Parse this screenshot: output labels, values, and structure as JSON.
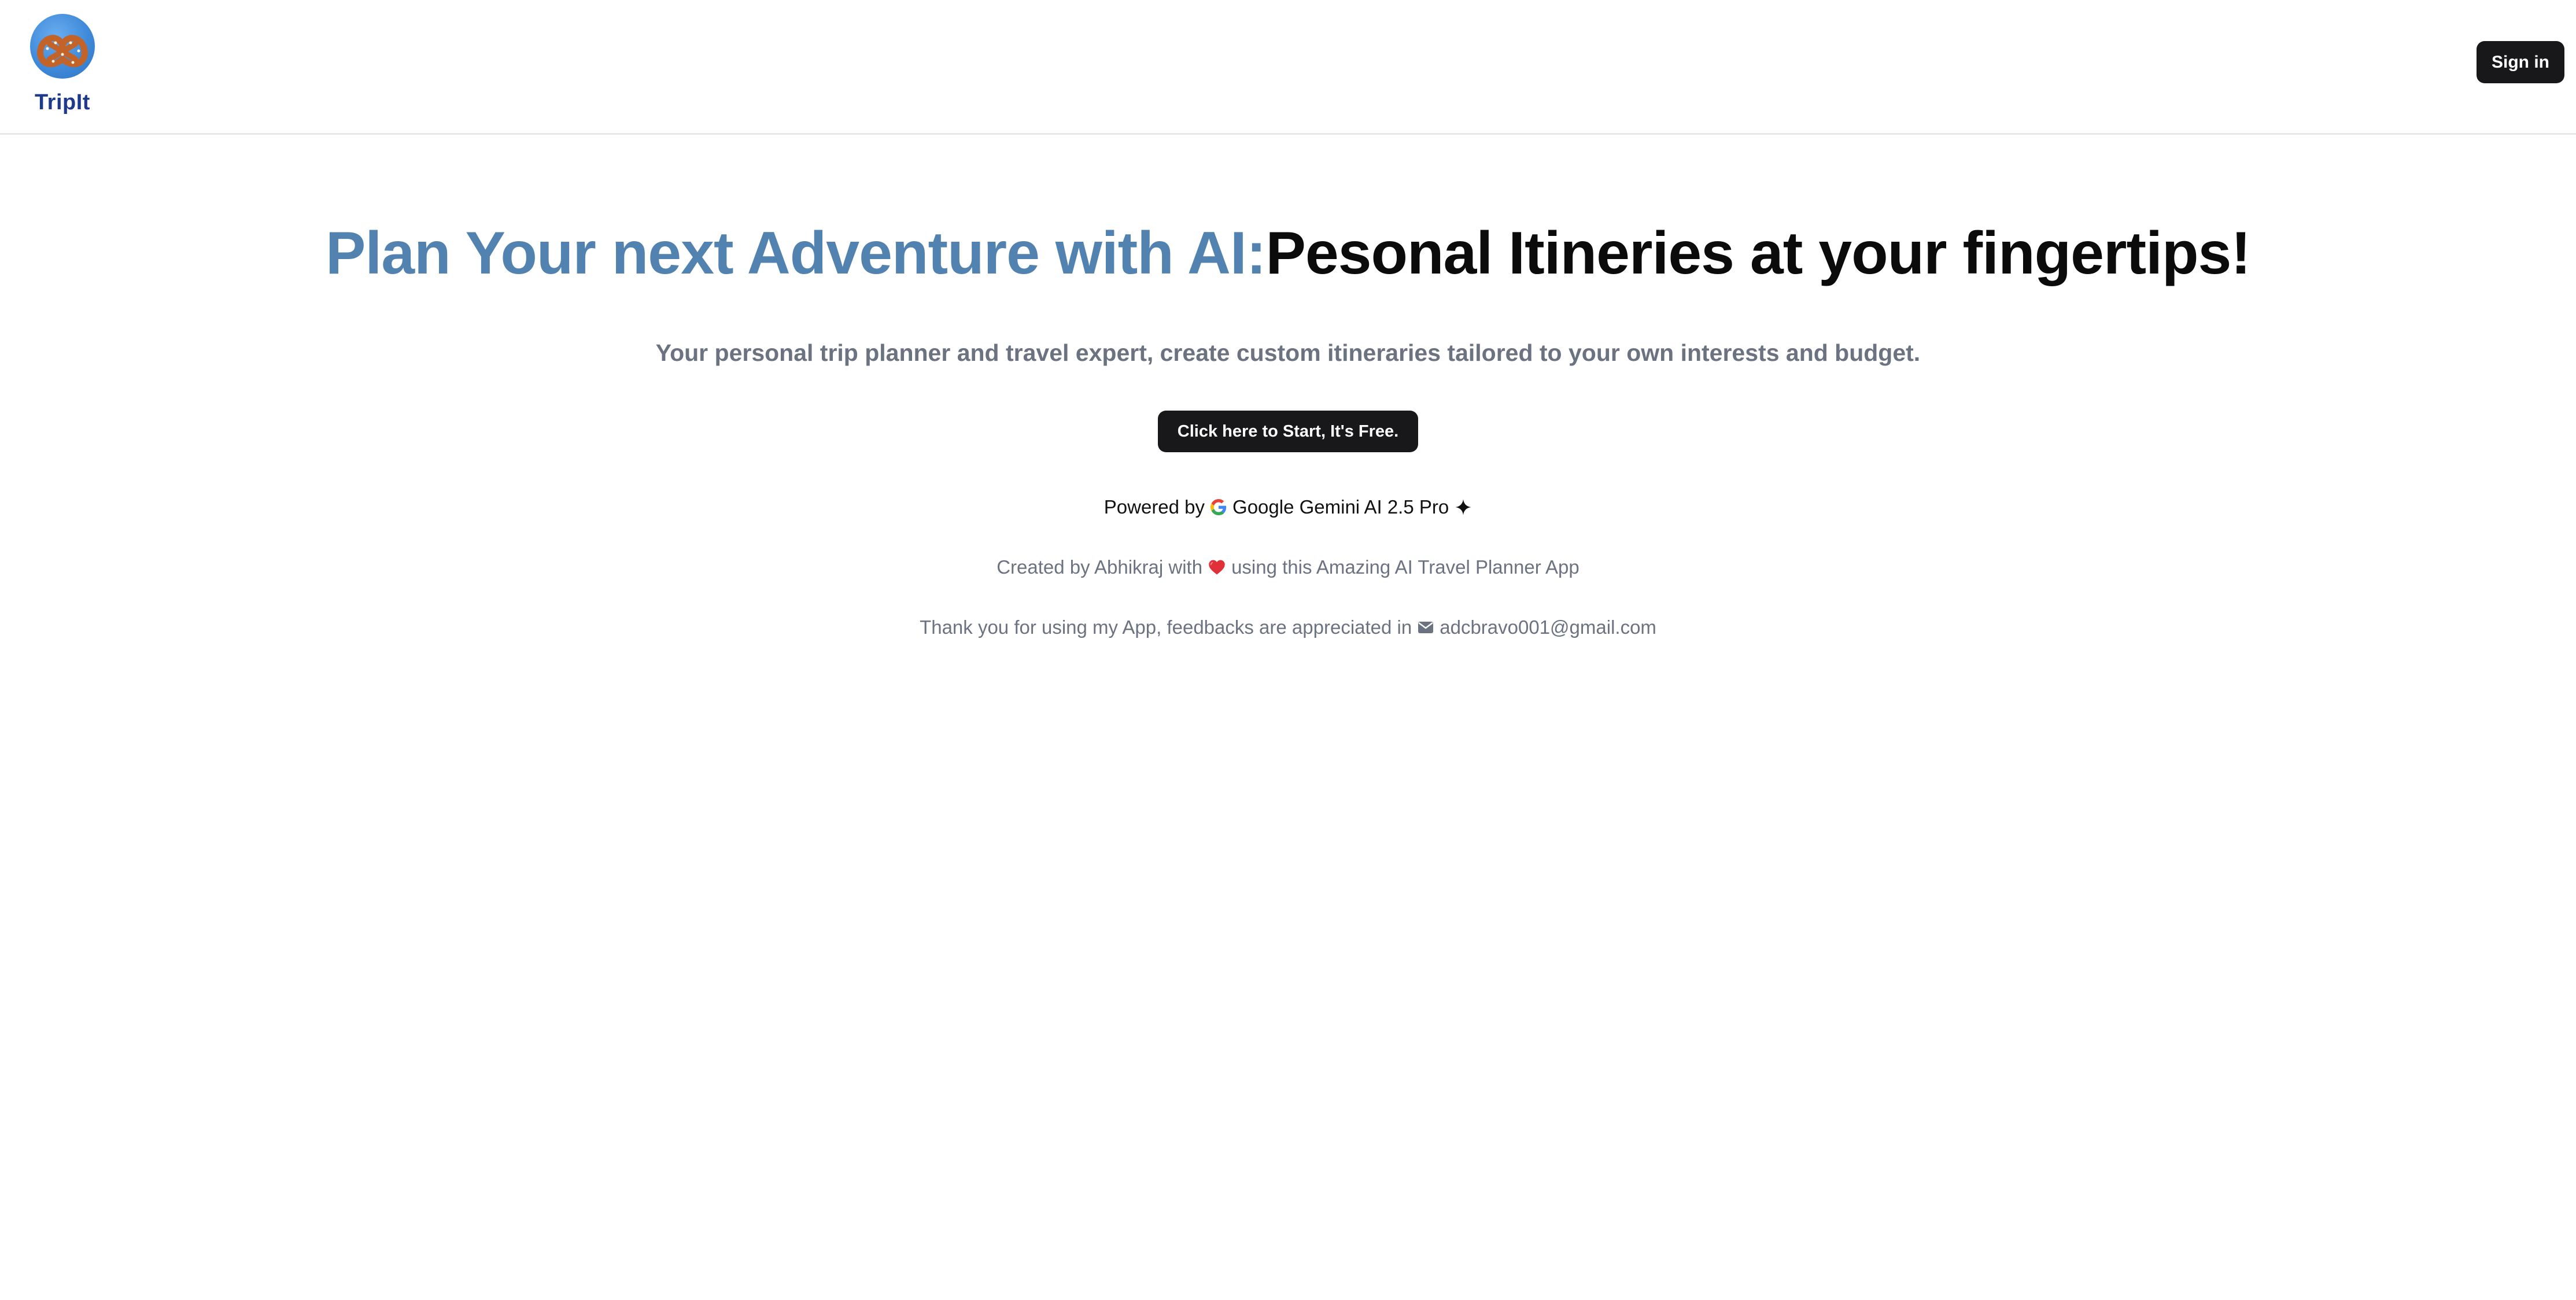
{
  "header": {
    "brand_name": "TripIt",
    "logo_icon": "pretzel-logo-icon",
    "signin_label": "Sign in"
  },
  "hero": {
    "title_accent": "Plan Your next Adventure with AI:",
    "title_dark": "Pesonal Itineries at your fingertips!",
    "subtitle": "Your personal trip planner and travel expert, create custom itineraries tailored to your own interests and budget.",
    "cta_label": "Click here to Start, It's Free."
  },
  "powered": {
    "prefix": "Powered by",
    "google_icon": "google-g-icon",
    "product": "Google Gemini AI 2.5 Pro",
    "sparkle_icon": "sparkle-icon"
  },
  "credits": {
    "created_prefix": "Created by Abhikraj with",
    "heart_icon": "heart-icon",
    "created_suffix": "using this Amazing AI Travel Planner App"
  },
  "thanks": {
    "text": "Thank you for using my App, feedbacks are appreciated in",
    "mail_icon": "mail-icon",
    "email": "adcbravo001@gmail.com"
  },
  "colors": {
    "accent": "#5282b0",
    "dark_button": "#18181b",
    "muted_text": "#6b7280",
    "brand_text": "#1e3a8a",
    "heart": "#e0313a"
  }
}
